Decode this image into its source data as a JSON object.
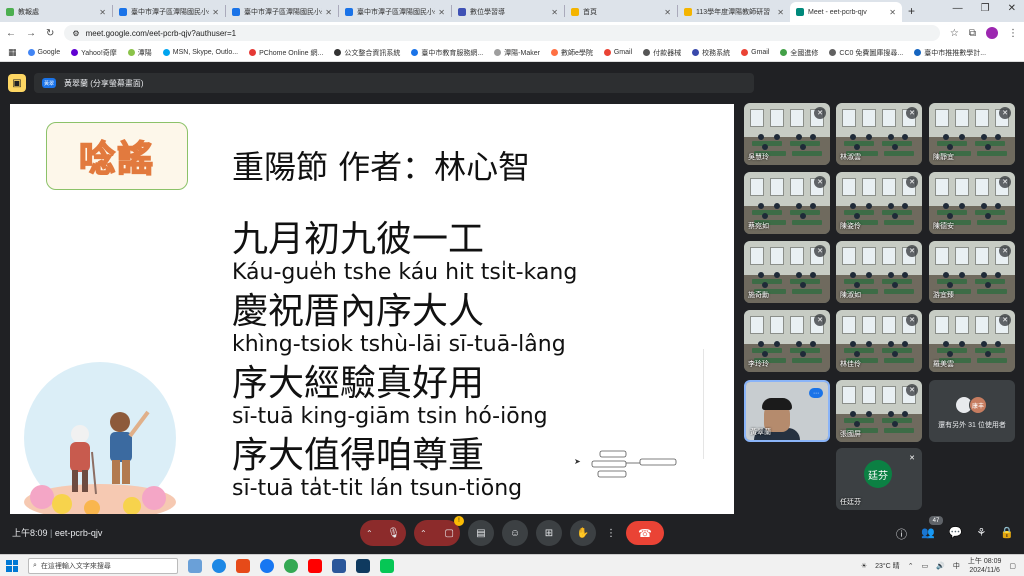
{
  "browser": {
    "tabs": [
      {
        "title": "教報處",
        "color": "#4caf50",
        "active": false
      },
      {
        "title": "臺中市潭子區潭陽國民小學",
        "color": "#1a73e8",
        "active": false
      },
      {
        "title": "臺中市潭子區潭陽國民小學",
        "color": "#1a73e8",
        "active": false
      },
      {
        "title": "臺中市潭子區潭陽國民小學",
        "color": "#1a73e8",
        "active": false
      },
      {
        "title": "數位學習導",
        "color": "#3f51b5",
        "active": false
      },
      {
        "title": "首頁",
        "color": "#f4b400",
        "active": false
      },
      {
        "title": "113學年度潭陽教師研習",
        "color": "#f4b400",
        "active": false
      },
      {
        "title": "Meet - eet-pcrb-qjv",
        "color": "#00897b",
        "active": true
      }
    ],
    "url": "meet.google.com/eet-pcrb-qjv?authuser=1",
    "bookmarks": [
      {
        "label": "Google",
        "color": "#4285f4"
      },
      {
        "label": "Yahoo!奇摩",
        "color": "#6001d2"
      },
      {
        "label": "潭陽",
        "color": "#8bc34a"
      },
      {
        "label": "MSN, Skype, Outlo...",
        "color": "#00a4ef"
      },
      {
        "label": "PChome Online 網...",
        "color": "#e53935"
      },
      {
        "label": "公文整合資訊系統",
        "color": "#333333"
      },
      {
        "label": "臺中市教育服務網...",
        "color": "#1a73e8"
      },
      {
        "label": "潭陽-Maker",
        "color": "#9e9e9e"
      },
      {
        "label": "數師e學院",
        "color": "#ff7043"
      },
      {
        "label": "Gmail",
        "color": "#ea4335"
      },
      {
        "label": "付款器械",
        "color": "#555555"
      },
      {
        "label": "校務系統",
        "color": "#3949ab"
      },
      {
        "label": "Gmail",
        "color": "#ea4335"
      },
      {
        "label": "全國進修",
        "color": "#43a047"
      },
      {
        "label": "CC0 免費圖庫搜尋...",
        "color": "#616161"
      },
      {
        "label": "臺中市推推數學計...",
        "color": "#1565c0"
      }
    ]
  },
  "meet": {
    "presenter_label": "黃翠蘭 (分享螢幕畫面)",
    "presenter_badge": "黃翠",
    "meeting_time": "上午8:09",
    "meeting_code": "eet-pcrb-qjv",
    "people_count": "47",
    "camera_badge": "!",
    "participants": [
      {
        "name": "吳慧玲",
        "muted": true
      },
      {
        "name": "林淑雲",
        "muted": true
      },
      {
        "name": "陳靜宜",
        "muted": true
      },
      {
        "name": "蔡宛如",
        "muted": true
      },
      {
        "name": "陳姿伶",
        "muted": true
      },
      {
        "name": "陳德安",
        "muted": true
      },
      {
        "name": "施奇勳",
        "muted": true
      },
      {
        "name": "陳淑如",
        "muted": true
      },
      {
        "name": "游宜臻",
        "muted": true
      },
      {
        "name": "李玲玲",
        "muted": true
      },
      {
        "name": "林佳伶",
        "muted": true
      },
      {
        "name": "羅美雲",
        "muted": true
      },
      {
        "name": "黃翠蘭",
        "muted": false
      },
      {
        "name": "張國屏",
        "muted": true
      }
    ],
    "others": {
      "label": "還有另外 31 位使用者",
      "avatar_text": "康丰"
    },
    "tingfen": {
      "initials": "廷芬",
      "name": "任廷芬"
    }
  },
  "slide": {
    "badge": "唸謠",
    "title": "重陽節  作者：林心智",
    "lines": [
      {
        "hanzi": "九月初九彼一工",
        "roman": "Káu-gue̍h tshe káu hit tsi̍t-kang"
      },
      {
        "hanzi": "慶祝厝內序大人",
        "roman": "khìng-tsiok tshù-lāi sī-tuā-lâng"
      },
      {
        "hanzi": "序大經驗真好用",
        "roman": "sī-tuā king-giām tsin hó-iōng"
      },
      {
        "hanzi": "序大值得咱尊重",
        "roman": "sī-tuā ta̍t-tit lán tsun-tiōng"
      }
    ]
  },
  "taskbar": {
    "search_placeholder": "在這裡輸入文字來搜尋",
    "weather": "23°C 晴",
    "time": "上午 08:09",
    "date": "2024/11/6",
    "lang": "中"
  }
}
